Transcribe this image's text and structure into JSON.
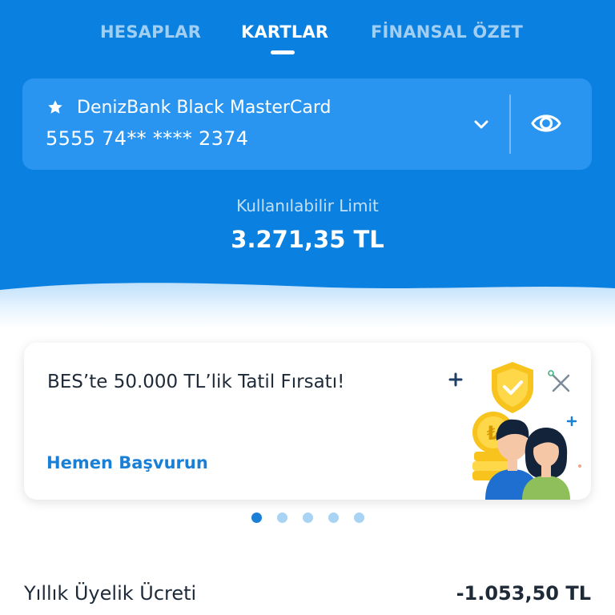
{
  "tabs": [
    {
      "label": "HESAPLAR",
      "active": false
    },
    {
      "label": "KARTLAR",
      "active": true
    },
    {
      "label": "FİNANSAL ÖZET",
      "active": false
    }
  ],
  "card": {
    "name": "DenizBank Black MasterCard",
    "number": "5555 74** **** 2374",
    "icons": [
      "star-icon",
      "chevron-down-icon",
      "eye-icon"
    ]
  },
  "limit": {
    "label": "Kullanılabilir Limit",
    "value": "3.271,35 TL"
  },
  "promo": {
    "title": "BES’te 50.000 TL’lik Tatil Fırsatı!",
    "cta": "Hemen Başvurun",
    "coin_symbol": "₺",
    "icons": [
      "close-icon",
      "shield-check-icon",
      "coin-icon",
      "people-illustration"
    ]
  },
  "carousel": {
    "total": 5,
    "active_index": 0
  },
  "fee": {
    "label": "Yıllık Üyelik Ücreti",
    "value": "-1.053,50 TL"
  },
  "colors": {
    "header_blue": "#0a80e0",
    "card_blue": "#2a95f0",
    "link_blue": "#1a7fd6",
    "dot_inactive": "#a9d3f2",
    "text_dark": "#1f2a38"
  }
}
